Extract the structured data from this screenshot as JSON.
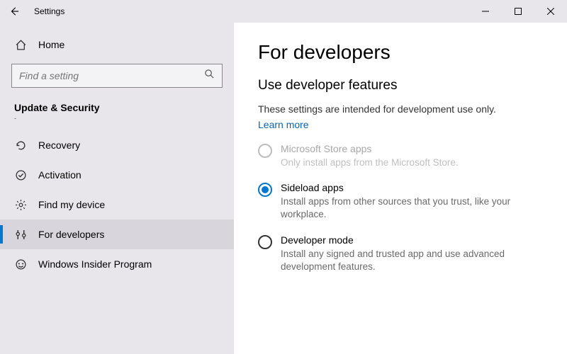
{
  "window": {
    "title": "Settings"
  },
  "sidebar": {
    "home_label": "Home",
    "search_placeholder": "Find a setting",
    "category_label": "Update & Security",
    "category_sub": "-",
    "items": [
      {
        "label": "Recovery"
      },
      {
        "label": "Activation"
      },
      {
        "label": "Find my device"
      },
      {
        "label": "For developers"
      },
      {
        "label": "Windows Insider Program"
      }
    ]
  },
  "page": {
    "title": "For developers",
    "section_title": "Use developer features",
    "section_desc": "These settings are intended for development use only.",
    "learn_more": "Learn more",
    "options": [
      {
        "label": "Microsoft Store apps",
        "desc": "Only install apps from the Microsoft Store."
      },
      {
        "label": "Sideload apps",
        "desc": "Install apps from other sources that you trust, like your workplace."
      },
      {
        "label": "Developer mode",
        "desc": "Install any signed and trusted app and use advanced development features."
      }
    ]
  }
}
